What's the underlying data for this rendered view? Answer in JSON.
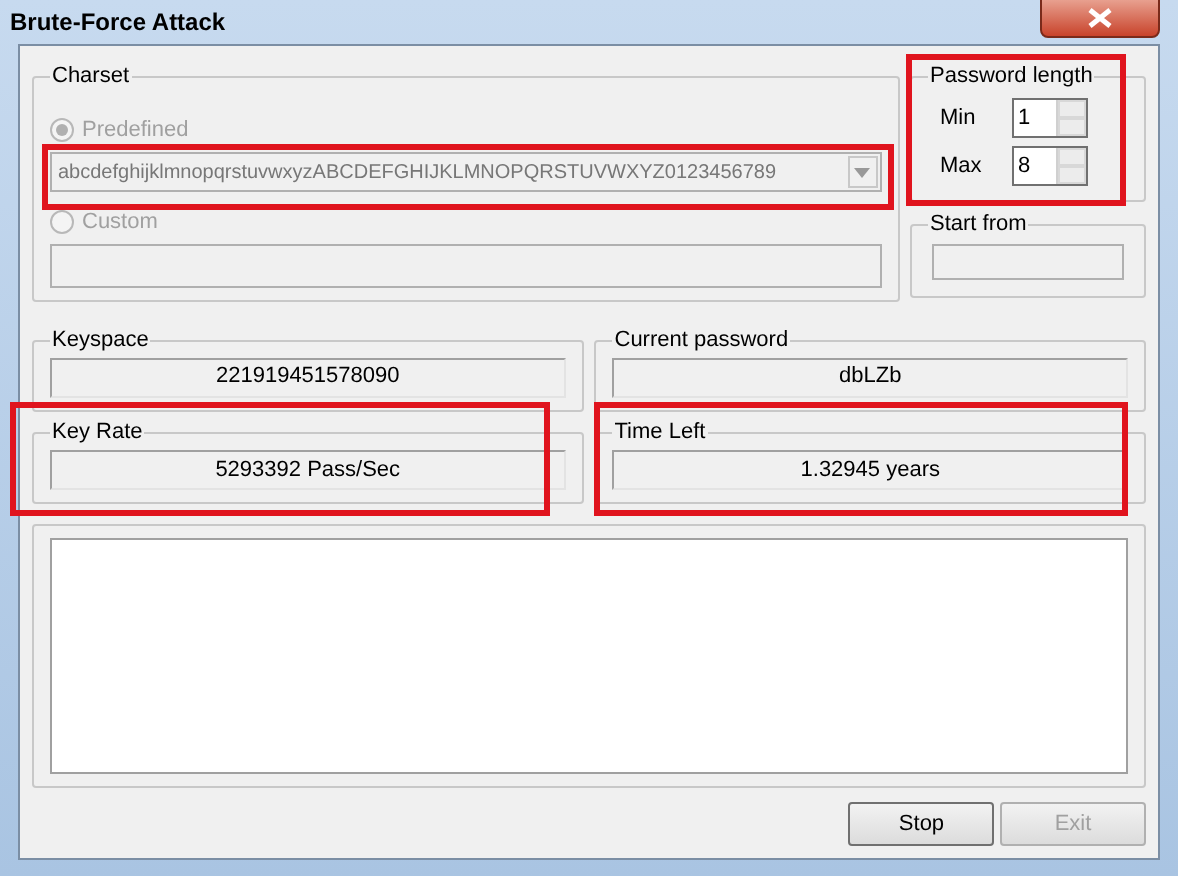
{
  "window": {
    "title": "Brute-Force Attack"
  },
  "charset": {
    "label": "Charset",
    "highlighted": true,
    "options": [
      {
        "label": "Predefined",
        "selected": true,
        "disabled": true,
        "kind": "dropdown",
        "value": "abcdefghijklmnopqrstuvwxyzABCDEFGHIJKLMNOPQRSTUVWXYZ0123456789"
      },
      {
        "label": "Custom",
        "selected": false,
        "disabled": true,
        "kind": "field"
      }
    ]
  },
  "password_length": {
    "label": "Password length",
    "highlighted": true,
    "fields": [
      {
        "label": "Min",
        "value": "1"
      },
      {
        "label": "Max",
        "value": "8"
      }
    ]
  },
  "start_from": {
    "label": "Start from"
  },
  "stats": [
    {
      "label": "Keyspace",
      "value": "221919451578090",
      "highlighted": false
    },
    {
      "label": "Current password",
      "value": "dbLZb",
      "highlighted": false
    },
    {
      "label": "Key Rate",
      "value": "5293392 Pass/Sec",
      "highlighted": true
    },
    {
      "label": "Time Left",
      "value": "1.32945 years",
      "highlighted": true
    }
  ],
  "buttons": [
    {
      "label": "Stop",
      "disabled": false
    },
    {
      "label": "Exit",
      "disabled": true
    }
  ]
}
